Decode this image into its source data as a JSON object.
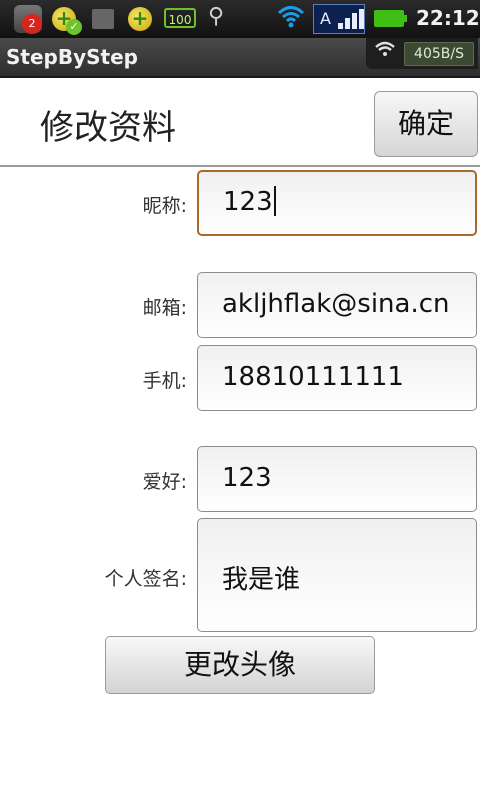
{
  "statusbar": {
    "notification_count": "2",
    "battery_text": "100",
    "signal_letter": "A",
    "time": "22:12",
    "icons": [
      "app-badge-icon",
      "clover-check-icon",
      "leaf-icon",
      "clover-plus-icon",
      "battery-100-icon",
      "usb-icon",
      "wifi-icon",
      "signal-icon",
      "battery-icon"
    ]
  },
  "titlebar": {
    "app_name": "StepByStep",
    "net_speed": "405B/S"
  },
  "header": {
    "title": "修改资料",
    "confirm_label": "确定"
  },
  "form": {
    "nickname": {
      "label": "昵称:",
      "value": "123"
    },
    "email": {
      "label": "邮箱:",
      "value": "akljhflak@sina.cn"
    },
    "phone": {
      "label": "手机:",
      "value": "18810111111"
    },
    "hobby": {
      "label": "爱好:",
      "value": "123"
    },
    "signature": {
      "label": "个人签名:",
      "value": "我是谁"
    }
  },
  "actions": {
    "change_avatar_label": "更改头像"
  },
  "colors": {
    "focus_border": "#a86a2a",
    "wifi": "#1e9be8",
    "battery": "#3fbf16",
    "badge": "#d8261f"
  }
}
